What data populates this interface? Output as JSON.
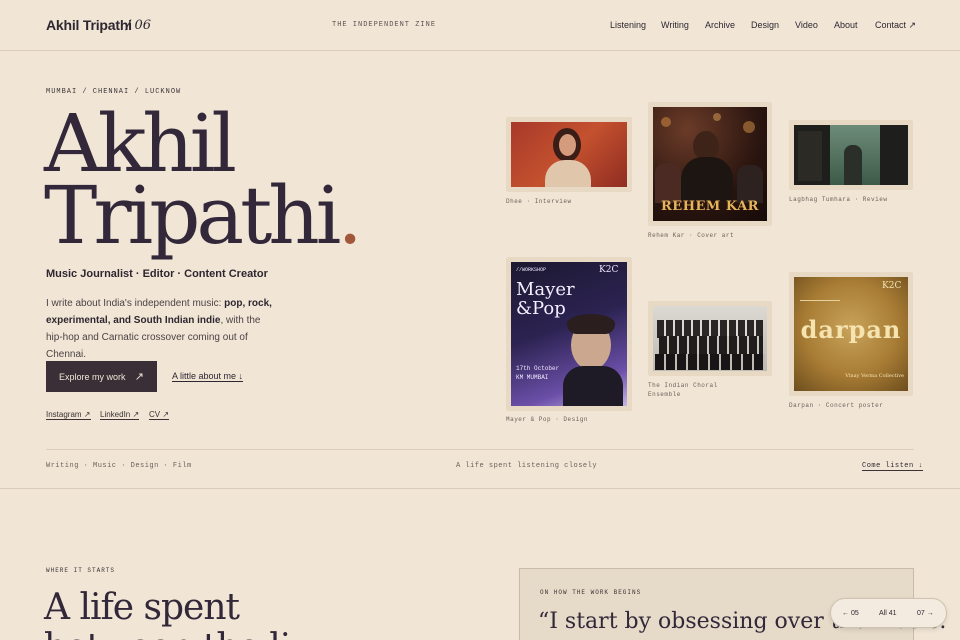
{
  "header": {
    "brand": "Akhil Tripathi",
    "issue": "/ 06",
    "tagline": "THE INDEPENDENT ZINE",
    "nav": [
      "Listening",
      "Writing",
      "Archive",
      "Design",
      "Video",
      "About",
      "Contact ↗"
    ]
  },
  "hero": {
    "locations": "MUMBAI / CHENNAI / LUCKNOW",
    "name_line1": "Akhil",
    "name_line2": "Tripathi",
    "name_dot": ".",
    "roles": "Music Journalist · Editor · Content Creator",
    "intro_prefix": "I write about India's independent music: ",
    "intro_bold": "pop, rock, experimental, and South Indian indie",
    "intro_suffix": ", with the hip-hop and Carnatic crossover coming out of Chennai.",
    "cta_label": "Explore my work",
    "cta_arrow": "↗",
    "about_link": "A little about me ↓",
    "social": [
      "Instagram ↗",
      "LinkedIn ↗",
      "CV ↗"
    ]
  },
  "gallery": [
    {
      "caption": "Dhee · Interview"
    },
    {
      "caption": "Rehem Kar · Cover art",
      "poster_title": "REHEM KAR"
    },
    {
      "caption": "Lagbhag Tumhara · Review"
    },
    {
      "caption": "Mayer & Pop · Design",
      "poster_title": "Mayer &Pop",
      "poster_tag": "//WORKSHOP",
      "poster_logo": "K2C",
      "poster_date": "17th October",
      "poster_venue": "KM MUMBAI"
    },
    {
      "caption": "The Indian Choral Ensemble"
    },
    {
      "caption": "Darpan · Concert poster",
      "poster_title": "darpan",
      "poster_logo": "K2C",
      "poster_sub": "Vinay Verma Collective"
    }
  ],
  "strip": {
    "topics": "Writing · Music · Design · Film",
    "motto": "A life spent listening closely",
    "listen": "Come listen ↓"
  },
  "section": {
    "eyebrow": "WHERE IT STARTS",
    "heading": "A life spent",
    "heading2": "between the li",
    "quote_eyebrow": "ON HOW THE WORK BEGINS",
    "quote": "“I start by obsessing over the music."
  },
  "pager": {
    "prev": "← 05",
    "all": "All 41",
    "next": "07 →"
  }
}
